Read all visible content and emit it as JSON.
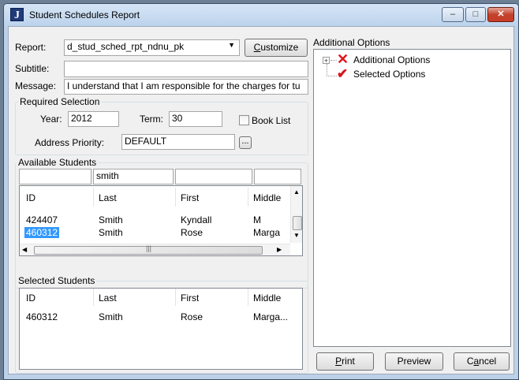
{
  "window": {
    "title": "Student Schedules Report",
    "minimize": "–",
    "maximize": "□",
    "close": "✕"
  },
  "form": {
    "report_label": "Report:",
    "report_value": "d_stud_sched_rpt_ndnu_pk",
    "customize_label": "Customize",
    "customize_hotkey": "C",
    "subtitle_label": "Subtitle:",
    "subtitle_value": "",
    "message_label": "Message:",
    "message_value": "I understand that I am responsible for the charges for tu"
  },
  "required": {
    "title": "Required Selection",
    "year_label": "Year:",
    "year_value": "2012",
    "term_label": "Term:",
    "term_value": "30",
    "booklist_label": "Book List",
    "booklist_checked": false,
    "priority_label": "Address Priority:",
    "priority_value": "DEFAULT",
    "browse_label": "..."
  },
  "available": {
    "title": "Available Students",
    "filters": [
      "",
      "smith",
      "",
      ""
    ],
    "headers": [
      "ID",
      "Last",
      "First",
      "Middle"
    ],
    "rows": [
      {
        "id": "424407",
        "last": "Smith",
        "first": "Kyndall",
        "middle": "M",
        "selected": false
      },
      {
        "id": "460312",
        "last": "Smith",
        "first": "Rose",
        "middle": "Marga",
        "selected": true
      }
    ]
  },
  "selected": {
    "title": "Selected Students",
    "headers": [
      "ID",
      "Last",
      "First",
      "Middle"
    ],
    "rows": [
      {
        "id": "460312",
        "last": "Smith",
        "first": "Rose",
        "middle": "Marga..."
      }
    ]
  },
  "options": {
    "title": "Additional Options",
    "tree": [
      "Additional Options",
      "Selected Options"
    ]
  },
  "buttons": {
    "print_label": "Print",
    "print_hotkey": "P",
    "preview_label": "Preview",
    "cancel_label": "Cancel",
    "cancel_hotkey": "a"
  }
}
